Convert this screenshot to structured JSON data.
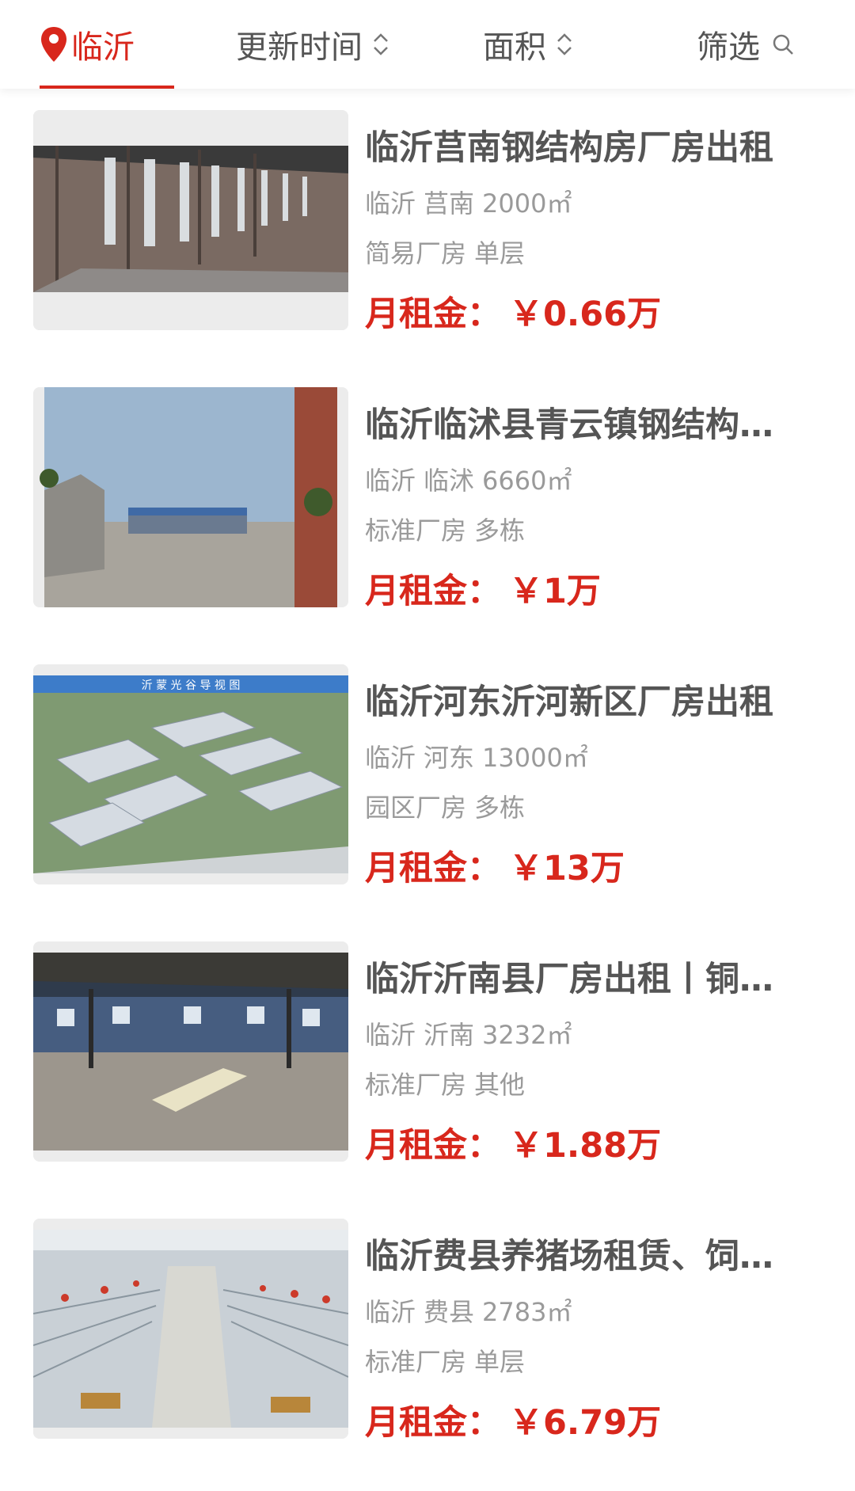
{
  "nav": {
    "city": "临沂",
    "sort_time": "更新时间",
    "sort_area": "面积",
    "filter": "筛选"
  },
  "accent_color": "#d8271c",
  "listings": [
    {
      "title": "临沂莒南钢结构房厂房出租",
      "city": "临沂",
      "district": "莒南",
      "area": "2000㎡",
      "type": "简易厂房",
      "floors": "单层",
      "price_label": "月租金：",
      "price": "￥0.66万",
      "image": "steel-structure-interior"
    },
    {
      "title": "临沂临沭县青云镇钢结构厂房出租",
      "city": "临沂",
      "district": "临沭",
      "area": "6660㎡",
      "type": "标准厂房",
      "floors": "多栋",
      "price_label": "月租金：",
      "price": "￥1万",
      "image": "yard-with-buildings"
    },
    {
      "title": "临沂河东沂河新区厂房出租",
      "city": "临沂",
      "district": "河东",
      "area": "13000㎡",
      "type": "园区厂房",
      "floors": "多栋",
      "price_label": "月租金：",
      "price": "￥13万",
      "image_caption": "沂 蒙 光 谷 导 视 图",
      "image": "industrial-park-aerial-map"
    },
    {
      "title": "临沂沂南县厂房出租丨铜井镇",
      "city": "临沂",
      "district": "沂南",
      "area": "3232㎡",
      "type": "标准厂房",
      "floors": "其他",
      "price_label": "月租金：",
      "price": "￥1.88万",
      "image": "empty-hall-interior"
    },
    {
      "title": "临沂费县养猪场租赁、饲料厂",
      "city": "临沂",
      "district": "费县",
      "area": "2783㎡",
      "type": "标准厂房",
      "floors": "单层",
      "price_label": "月租金：",
      "price": "￥6.79万",
      "image": "pig-farm-interior"
    }
  ]
}
